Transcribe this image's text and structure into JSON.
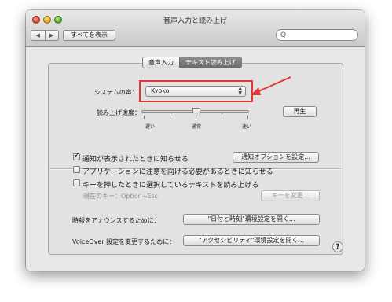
{
  "window": {
    "title": "音声入力と読み上げ"
  },
  "toolbar": {
    "back": "◀",
    "forward": "▶",
    "show_all": "すべてを表示",
    "search_icon": "Q"
  },
  "tabs": [
    {
      "label": "音声入力",
      "selected": false
    },
    {
      "label": "テキスト読み上げ",
      "selected": true
    }
  ],
  "voice": {
    "label": "システムの声：",
    "value": "Kyoko"
  },
  "rate": {
    "label": "読み上げ速度：",
    "slow": "遅い",
    "normal": "通常",
    "fast": "速い",
    "play_button": "再生",
    "level": 0.5
  },
  "options": [
    {
      "label": "通知が表示されたときに知らせる",
      "checked": true,
      "button": "通知オプションを設定..."
    },
    {
      "label": "アプリケーションに注意を向ける必要があるときに知らせる",
      "checked": false
    },
    {
      "label": "キーを押したときに選択しているテキストを読み上げる",
      "checked": false
    },
    {
      "label": "現在のキー：Option+Esc",
      "button": "キーを変更..."
    }
  ],
  "announce": {
    "label": "時報をアナウンスするために：",
    "button": "\"日付と時刻\"環境設定を開く..."
  },
  "voiceover": {
    "label": "VoiceOver 設定を変更するために：",
    "button": "\"アクセシビリティ\"環境設定を開く..."
  },
  "help": "?",
  "colors": {
    "highlight": "#e03a36",
    "window_bg": "#e8e8e8"
  }
}
